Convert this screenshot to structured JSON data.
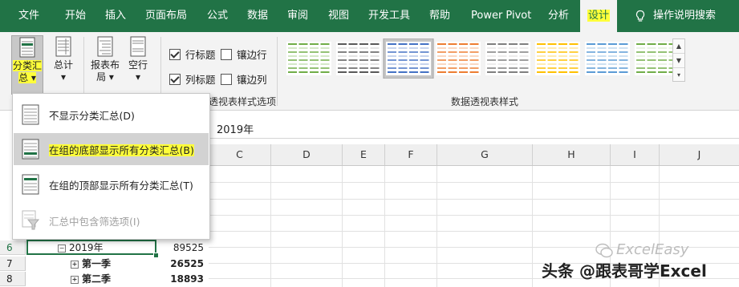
{
  "ribbon_tabs": [
    {
      "label": "文件"
    },
    {
      "label": "开始"
    },
    {
      "label": "插入"
    },
    {
      "label": "页面布局"
    },
    {
      "label": "公式"
    },
    {
      "label": "数据"
    },
    {
      "label": "审阅"
    },
    {
      "label": "视图"
    },
    {
      "label": "开发工具"
    },
    {
      "label": "帮助"
    },
    {
      "label": "Power Pivot"
    },
    {
      "label": "分析"
    },
    {
      "label": "设计"
    },
    {
      "label": "操作说明搜索"
    }
  ],
  "layout_group": {
    "subtotals": "分类汇\n总 ▾",
    "grand_totals": "总计\n▾",
    "report_layout": "报表布\n局 ▾",
    "blank_rows": "空行\n▾"
  },
  "options_group": {
    "row_headers": "行标题",
    "banded_rows": "镶边行",
    "column_headers": "列标题",
    "banded_columns": "镶边列",
    "label": "数据透视表样式选项"
  },
  "styles_group": {
    "label": "数据透视表样式",
    "thumbnails": [
      {
        "accent": "#70ad47",
        "stripe": "#c6e0b4"
      },
      {
        "accent": "#595959",
        "stripe": "#d9d9d9"
      },
      {
        "accent": "#4472c4",
        "stripe": "#b4c6e7"
      },
      {
        "accent": "#ed7d31",
        "stripe": "#f8cbad"
      },
      {
        "accent": "#7f7f7f",
        "stripe": "#e7e6e6"
      },
      {
        "accent": "#ffc000",
        "stripe": "#ffe699"
      },
      {
        "accent": "#5b9bd5",
        "stripe": "#bdd7ee"
      },
      {
        "accent": "#70ad47",
        "stripe": "#e2efda"
      }
    ]
  },
  "dropdown_menu": {
    "items": [
      {
        "label": "不显示分类汇总(D)"
      },
      {
        "label": "在组的底部显示所有分类汇总(B)"
      },
      {
        "label": "在组的顶部显示所有分类汇总(T)"
      },
      {
        "label": "汇总中包含筛选项(I)"
      }
    ]
  },
  "formula_bar": {
    "value": "2019年"
  },
  "columns": [
    "C",
    "D",
    "E",
    "F",
    "G",
    "H",
    "I",
    "J"
  ],
  "rows": [
    {
      "num": "6",
      "label": "2019年",
      "value": "89525"
    },
    {
      "num": "7",
      "label": "第一季",
      "value": "26525"
    },
    {
      "num": "8",
      "label": "第二季",
      "value": "18893"
    }
  ],
  "watermark": {
    "brand": "ExcelEasy",
    "source": "头条 @跟表哥学Excel"
  },
  "colors": {
    "ribbon_green": "#217346",
    "highlight_yellow": "#ffff3a"
  }
}
